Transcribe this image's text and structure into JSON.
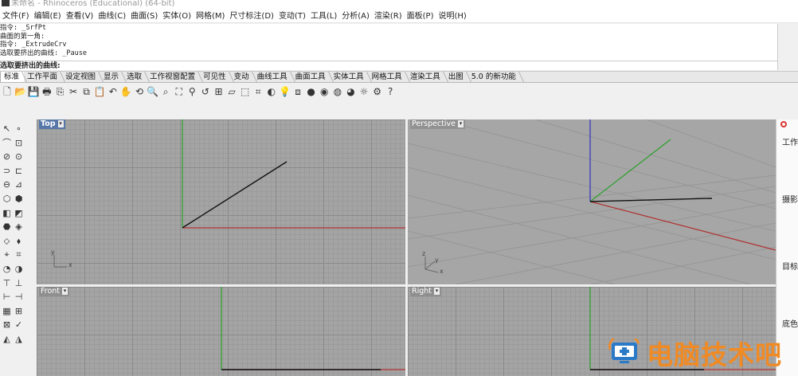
{
  "window": {
    "title": "未命名 - Rhinoceros (Educational) (64-bit)"
  },
  "menu": [
    "文件(F)",
    "编辑(E)",
    "查看(V)",
    "曲线(C)",
    "曲面(S)",
    "实体(O)",
    "网格(M)",
    "尺寸标注(D)",
    "变动(T)",
    "工具(L)",
    "分析(A)",
    "渲染(R)",
    "面板(P)",
    "说明(H)"
  ],
  "command_history": [
    "指令: _SrfPt",
    "曲面的第一角:",
    "指令: _ExtrudeCrv",
    "选取要挤出的曲线: _Pause"
  ],
  "command_prompt": "选取要挤出的曲线:",
  "tabs": [
    "标准",
    "工作平面",
    "设定视图",
    "显示",
    "选取",
    "工作视窗配置",
    "可见性",
    "变动",
    "曲线工具",
    "曲面工具",
    "实体工具",
    "网格工具",
    "渲染工具",
    "出图",
    "5.0 的新功能"
  ],
  "active_tab": "标准",
  "toolbar_icons": [
    "new-icon",
    "open-icon",
    "save-icon",
    "print-icon",
    "import-icon",
    "cut-icon",
    "copy-icon",
    "paste-icon",
    "undo-icon",
    "pan-icon",
    "rotate-view-icon",
    "zoom-icon",
    "zoom-window-icon",
    "zoom-extents-icon",
    "zoom-selected-icon",
    "undo-view-icon",
    "four-viewports-icon",
    "construction-plane-icon",
    "select-icon",
    "grid-snap-icon",
    "shade-icon",
    "light-icon",
    "layer-icon",
    "color-icon",
    "rendered-sphere-icon",
    "render-icon",
    "material-icon",
    "sun-icon",
    "options-icon",
    "help-icon"
  ],
  "viewports": {
    "top": {
      "label": "Top",
      "axis_x": "x",
      "axis_y": "y"
    },
    "perspective": {
      "label": "Perspective",
      "axis_x": "x",
      "axis_y": "y",
      "axis_z": "z"
    },
    "front": {
      "label": "Front"
    },
    "right": {
      "label": "Right"
    }
  },
  "right_panel": {
    "items": [
      "工作",
      "摄影",
      "目标",
      "底色"
    ]
  },
  "watermark": {
    "text": "电脑技术吧"
  },
  "colors": {
    "x_axis": "#b03030",
    "y_axis": "#2aa02a",
    "z_axis": "#3030c0",
    "active_label": "#5677a8",
    "watermark": "#f08a24"
  }
}
